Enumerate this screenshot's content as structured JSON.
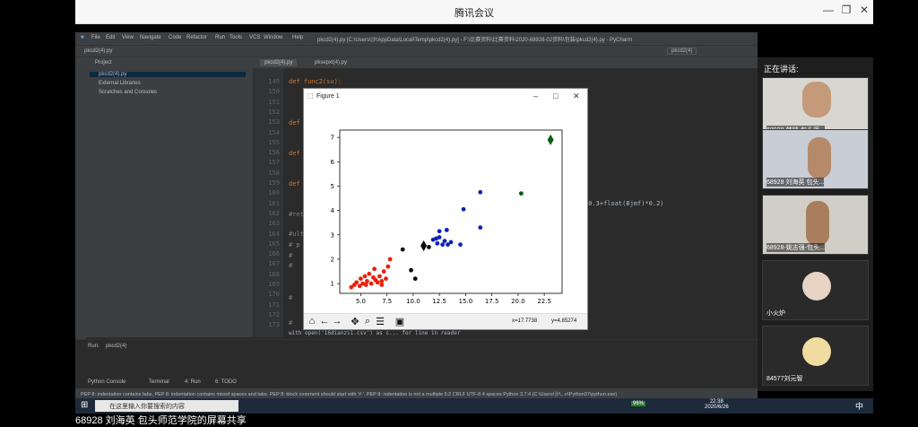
{
  "meeting": {
    "title": "腾讯会议",
    "min": "—",
    "restore": "❐",
    "close": "✕"
  },
  "ide": {
    "menu": [
      "File",
      "Edit",
      "View",
      "Navigate",
      "Code",
      "Refactor",
      "Run",
      "Tools",
      "VCS",
      "Window",
      "Help"
    ],
    "window_title": "pkcd2(4).py [C:\\Users\\沙\\AppData\\Local\\Temp\\pkcd2(4).py] - F:\\比赛资料\\比赛资料\\2020-68928-02资料\\包装\\pkcd2(4).py - PyCharm",
    "breadcrumb": "pkcd2(4).py",
    "run_config": "pkcd2(4)",
    "project_label": "Project",
    "tabs": [
      "pkcd2(4).py",
      "pksepxt(4).py"
    ],
    "tree": [
      "pkcd2(4).py",
      "External Libraries",
      "Scratches and Consoles"
    ],
    "line_numbers": [
      "149",
      "150",
      "151",
      "152",
      "153",
      "154",
      "155",
      "156",
      "157",
      "158",
      "159",
      "160",
      "161",
      "162",
      "163",
      "164",
      "165",
      "166",
      "167",
      "168",
      "169",
      "170",
      "171",
      "172",
      "173"
    ],
    "code_def1": "def func2(su):",
    "code_def_short": "def f",
    "code_ret": "#ret",
    "code_ult": "#ulth",
    "code_p": "#  p",
    "code_hash": "#",
    "code_tail": "*0.3+float(Bjmf)*0.2)",
    "code_bottom": "with open('16dianzi1.csv') as c...    for line in reader",
    "run_label": "Run:",
    "run_tab": "pkcd2(4)",
    "bottom_tabs": [
      "Python Console",
      "Terminal",
      "4: Run",
      "6: TODO"
    ],
    "status": "PEP 8: indentation contains tabs, PEP 8: indentation contains mixed spaces and tabs. PEP 8: block comment should start with '# '. PEP 8: indentation is not a multiple   5:2   CRLF   UTF-8   4 spaces   Python 3.7.4 (C:\\Users\\沙\\...n\\Python37\\python.exe)"
  },
  "figure": {
    "title": "Figure 1",
    "coord_x": "x=17.7738",
    "coord_y": "y=4.85274",
    "toolbar_icons": [
      "home-icon",
      "back-icon",
      "forward-icon",
      "pan-icon",
      "zoom-icon",
      "configure-icon",
      "save-icon"
    ]
  },
  "chart_data": {
    "type": "scatter",
    "xlim": [
      3.0,
      24.2
    ],
    "ylim": [
      0.6,
      7.3
    ],
    "xticks": [
      "5.0",
      "7.5",
      "10.0",
      "12.5",
      "15.0",
      "17.5",
      "20.0",
      "22.5"
    ],
    "yticks": [
      "1",
      "2",
      "3",
      "4",
      "5",
      "6",
      "7"
    ],
    "grid": false,
    "series": [
      {
        "color": "#e8200c",
        "marker": "circle",
        "points": [
          [
            4.1,
            0.85
          ],
          [
            4.4,
            0.95
          ],
          [
            4.6,
            1.05
          ],
          [
            4.9,
            0.9
          ],
          [
            5.0,
            1.2
          ],
          [
            5.2,
            1.0
          ],
          [
            5.4,
            1.3
          ],
          [
            5.6,
            1.1
          ],
          [
            5.8,
            1.4
          ],
          [
            6.0,
            1.0
          ],
          [
            6.2,
            1.25
          ],
          [
            6.4,
            1.15
          ],
          [
            6.6,
            1.05
          ],
          [
            6.8,
            1.3
          ],
          [
            7.0,
            1.1
          ],
          [
            7.2,
            1.5
          ],
          [
            7.4,
            1.2
          ],
          [
            7.6,
            1.7
          ],
          [
            7.8,
            2.0
          ],
          [
            6.3,
            1.6
          ],
          [
            5.5,
            0.95
          ],
          [
            7.0,
            0.95
          ]
        ]
      },
      {
        "color": "#0a0a0a",
        "marker": "circle",
        "points": [
          [
            9.0,
            2.4
          ],
          [
            10.2,
            1.2
          ],
          [
            9.8,
            1.55
          ],
          [
            11.5,
            2.5
          ]
        ]
      },
      {
        "color": "#0a0a0a",
        "marker": "diamond",
        "points": [
          [
            11.0,
            2.55
          ]
        ]
      },
      {
        "color": "#1021b8",
        "marker": "circle",
        "points": [
          [
            11.9,
            2.8
          ],
          [
            12.3,
            2.65
          ],
          [
            12.5,
            2.9
          ],
          [
            12.8,
            2.6
          ],
          [
            13.0,
            2.75
          ],
          [
            13.3,
            2.6
          ],
          [
            13.6,
            2.7
          ],
          [
            12.5,
            3.15
          ],
          [
            13.2,
            3.2
          ],
          [
            14.8,
            4.05
          ],
          [
            16.4,
            4.75
          ],
          [
            16.4,
            3.3
          ],
          [
            14.5,
            2.6
          ],
          [
            12.2,
            2.85
          ]
        ]
      },
      {
        "color": "#0c5c12",
        "marker": "circle",
        "points": [
          [
            20.3,
            4.7
          ]
        ]
      },
      {
        "color": "#0c5c12",
        "marker": "diamond",
        "points": [
          [
            23.1,
            6.9
          ]
        ]
      }
    ]
  },
  "sidebar": {
    "heading": "正在讲话:",
    "participants": [
      {
        "label": "68928-韩帅-包头师..."
      },
      {
        "label": "68928 刘海英 包头..."
      },
      {
        "label": "68928-姚志强-包头..."
      },
      {
        "label": "小火炉"
      },
      {
        "label": "84577刘元智"
      }
    ]
  },
  "taskbar": {
    "search": "在这里输入你要搜索的内容",
    "battery": "96%",
    "time": "22:38",
    "date": "2020/6/26",
    "ime": "中"
  },
  "caption": "68928 刘海英 包头师范学院的屏幕共享"
}
